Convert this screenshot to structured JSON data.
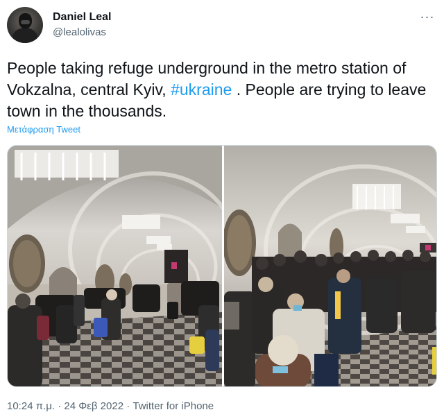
{
  "author": {
    "name": "Daniel Leal",
    "handle": "@lealolivas",
    "avatar_icon": "avatar-photo"
  },
  "tweet": {
    "text_before": "People taking refuge underground in the metro station of Vokzalna, central Kyiv, ",
    "hashtag": "#ukraine",
    "text_after": " . People are trying to leave town in the thousands.",
    "translate_label": "Μετάφραση Tweet"
  },
  "media": {
    "photo_count": 2,
    "left_photo_icon": "metro-station-photo",
    "right_photo_icon": "metro-crowd-photo"
  },
  "footer": {
    "time": "10:24 π.μ.",
    "date": "24 Φεβ 2022",
    "separator": "·",
    "source": "Twitter for iPhone"
  },
  "colors": {
    "link": "#1d9bf0",
    "secondary_text": "#536471",
    "primary_text": "#0f1419"
  },
  "more_icon": "more-options-icon"
}
